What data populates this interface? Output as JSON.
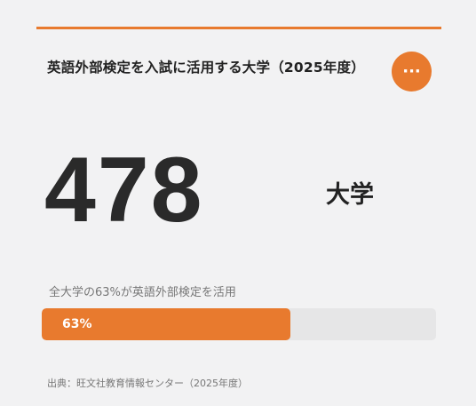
{
  "card": {
    "title": "英語外部検定を入試に活用する大学（2025年度）",
    "more_button": "···",
    "accent_color": "#e87a2e"
  },
  "stat": {
    "value": "478",
    "unit": "大学"
  },
  "usage": {
    "caption": "全大学の63%が英語外部検定を活用",
    "percent": 63,
    "percent_label": "63%"
  },
  "source": "出典：旺文社教育情報センター（2025年度）"
}
